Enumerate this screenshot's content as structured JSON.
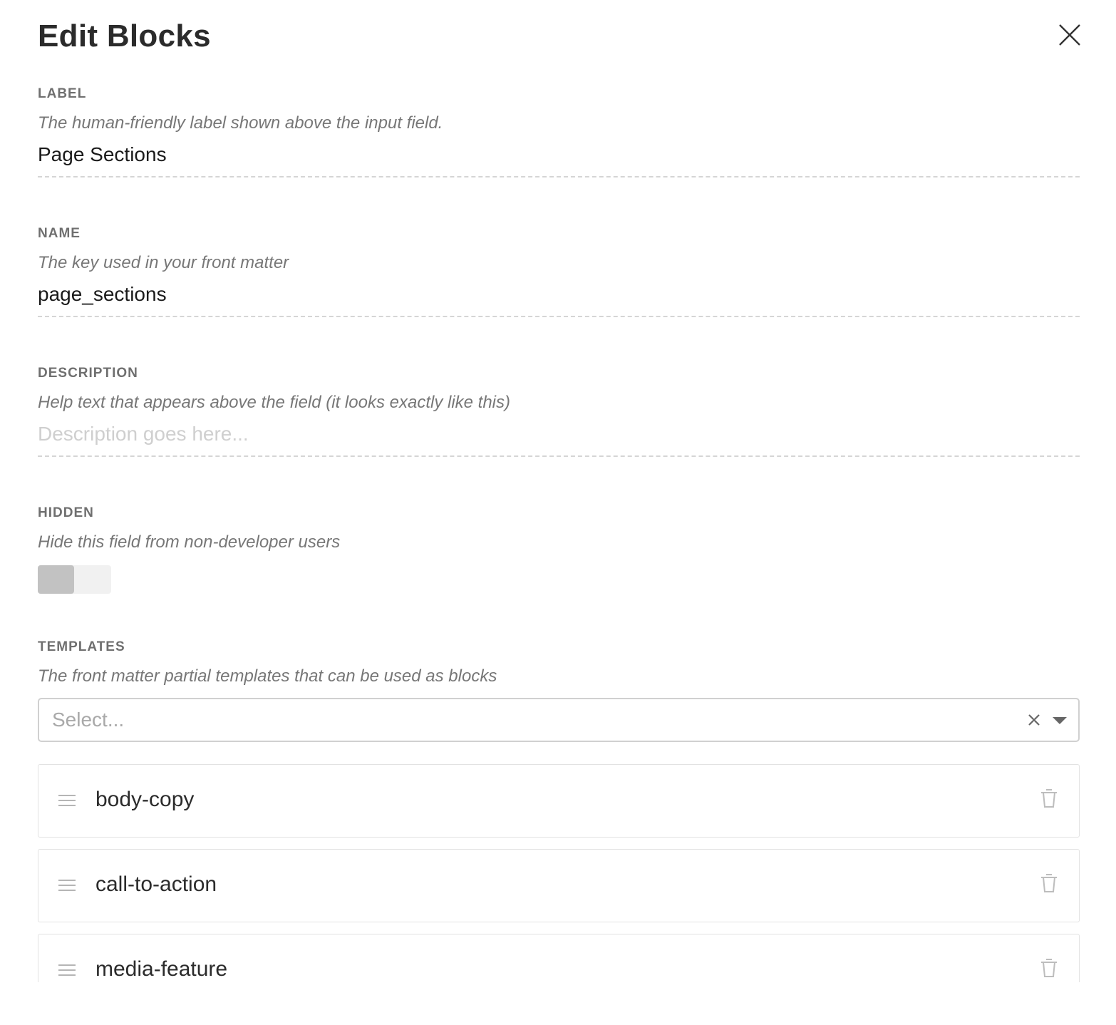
{
  "modal": {
    "title": "Edit Blocks",
    "close_icon": "close-icon"
  },
  "fields": {
    "label": {
      "title": "LABEL",
      "description": "The human-friendly label shown above the input field.",
      "value": "Page Sections"
    },
    "name": {
      "title": "NAME",
      "description": "The key used in your front matter",
      "value": "page_sections"
    },
    "description": {
      "title": "DESCRIPTION",
      "description": "Help text that appears above the field (it looks exactly like this)",
      "value": "",
      "placeholder": "Description goes here..."
    },
    "hidden": {
      "title": "HIDDEN",
      "description": "Hide this field from non-developer users",
      "checked": false
    },
    "templates": {
      "title": "TEMPLATES",
      "description": "The front matter partial templates that can be used as blocks",
      "select_placeholder": "Select...",
      "clear_icon": "clear-icon",
      "caret_icon": "chevron-down-icon",
      "items": [
        {
          "name": "body-copy"
        },
        {
          "name": "call-to-action"
        },
        {
          "name": "media-feature"
        }
      ]
    }
  },
  "colors": {
    "text": "#2b2b2b",
    "label": "#6f6f6f",
    "muted": "#777777",
    "border": "#d0d0d0"
  }
}
